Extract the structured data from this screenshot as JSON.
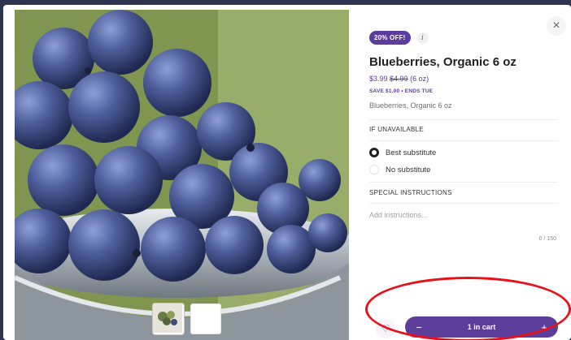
{
  "modal": {
    "close_icon_glyph": "×",
    "discount_badge": "20% OFF!",
    "info_glyph": "i",
    "product_title": "Blueberries, Organic 6 oz",
    "price_current": "$3.99",
    "price_original": "$4.99",
    "price_unit": "(6 oz)",
    "save_note": "SAVE $1.00 • ENDS TUE",
    "subtitle": "Blueberries, Organic 6 oz",
    "if_unavailable_label": "IF UNAVAILABLE",
    "options": [
      {
        "label": "Best substitute",
        "selected": true
      },
      {
        "label": "No substitute",
        "selected": false
      }
    ],
    "special_instructions_label": "SPECIAL INSTRUCTIONS",
    "instructions_placeholder": "Add instructions...",
    "char_counter": "0 / 150",
    "favorite_glyph": "♡",
    "cart": {
      "minus_glyph": "−",
      "label": "1 in cart",
      "plus_glyph": "+"
    }
  },
  "colors": {
    "brand_purple": "#5c3d99",
    "annotation_red": "#e8101b"
  }
}
